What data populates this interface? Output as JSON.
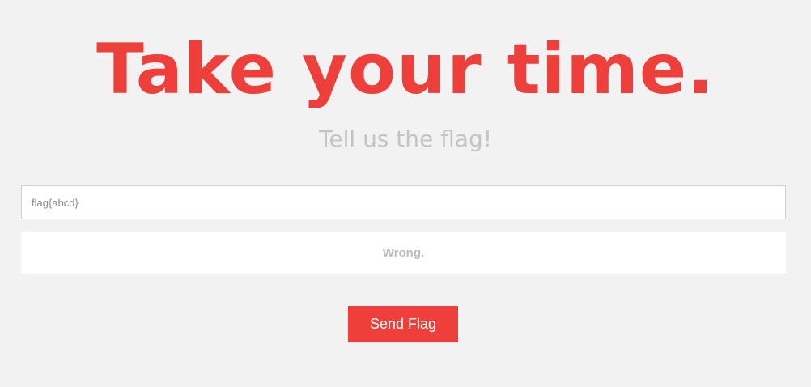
{
  "header": {
    "title": "Take your time.",
    "subtitle": "Tell us the flag!"
  },
  "form": {
    "flag_input_value": "flag{abcd}",
    "result_message": "Wrong.",
    "send_button_label": "Send Flag"
  },
  "colors": {
    "accent": "#ee3f3b",
    "background": "#f2f2f2",
    "muted_text": "#c4c4c4"
  }
}
